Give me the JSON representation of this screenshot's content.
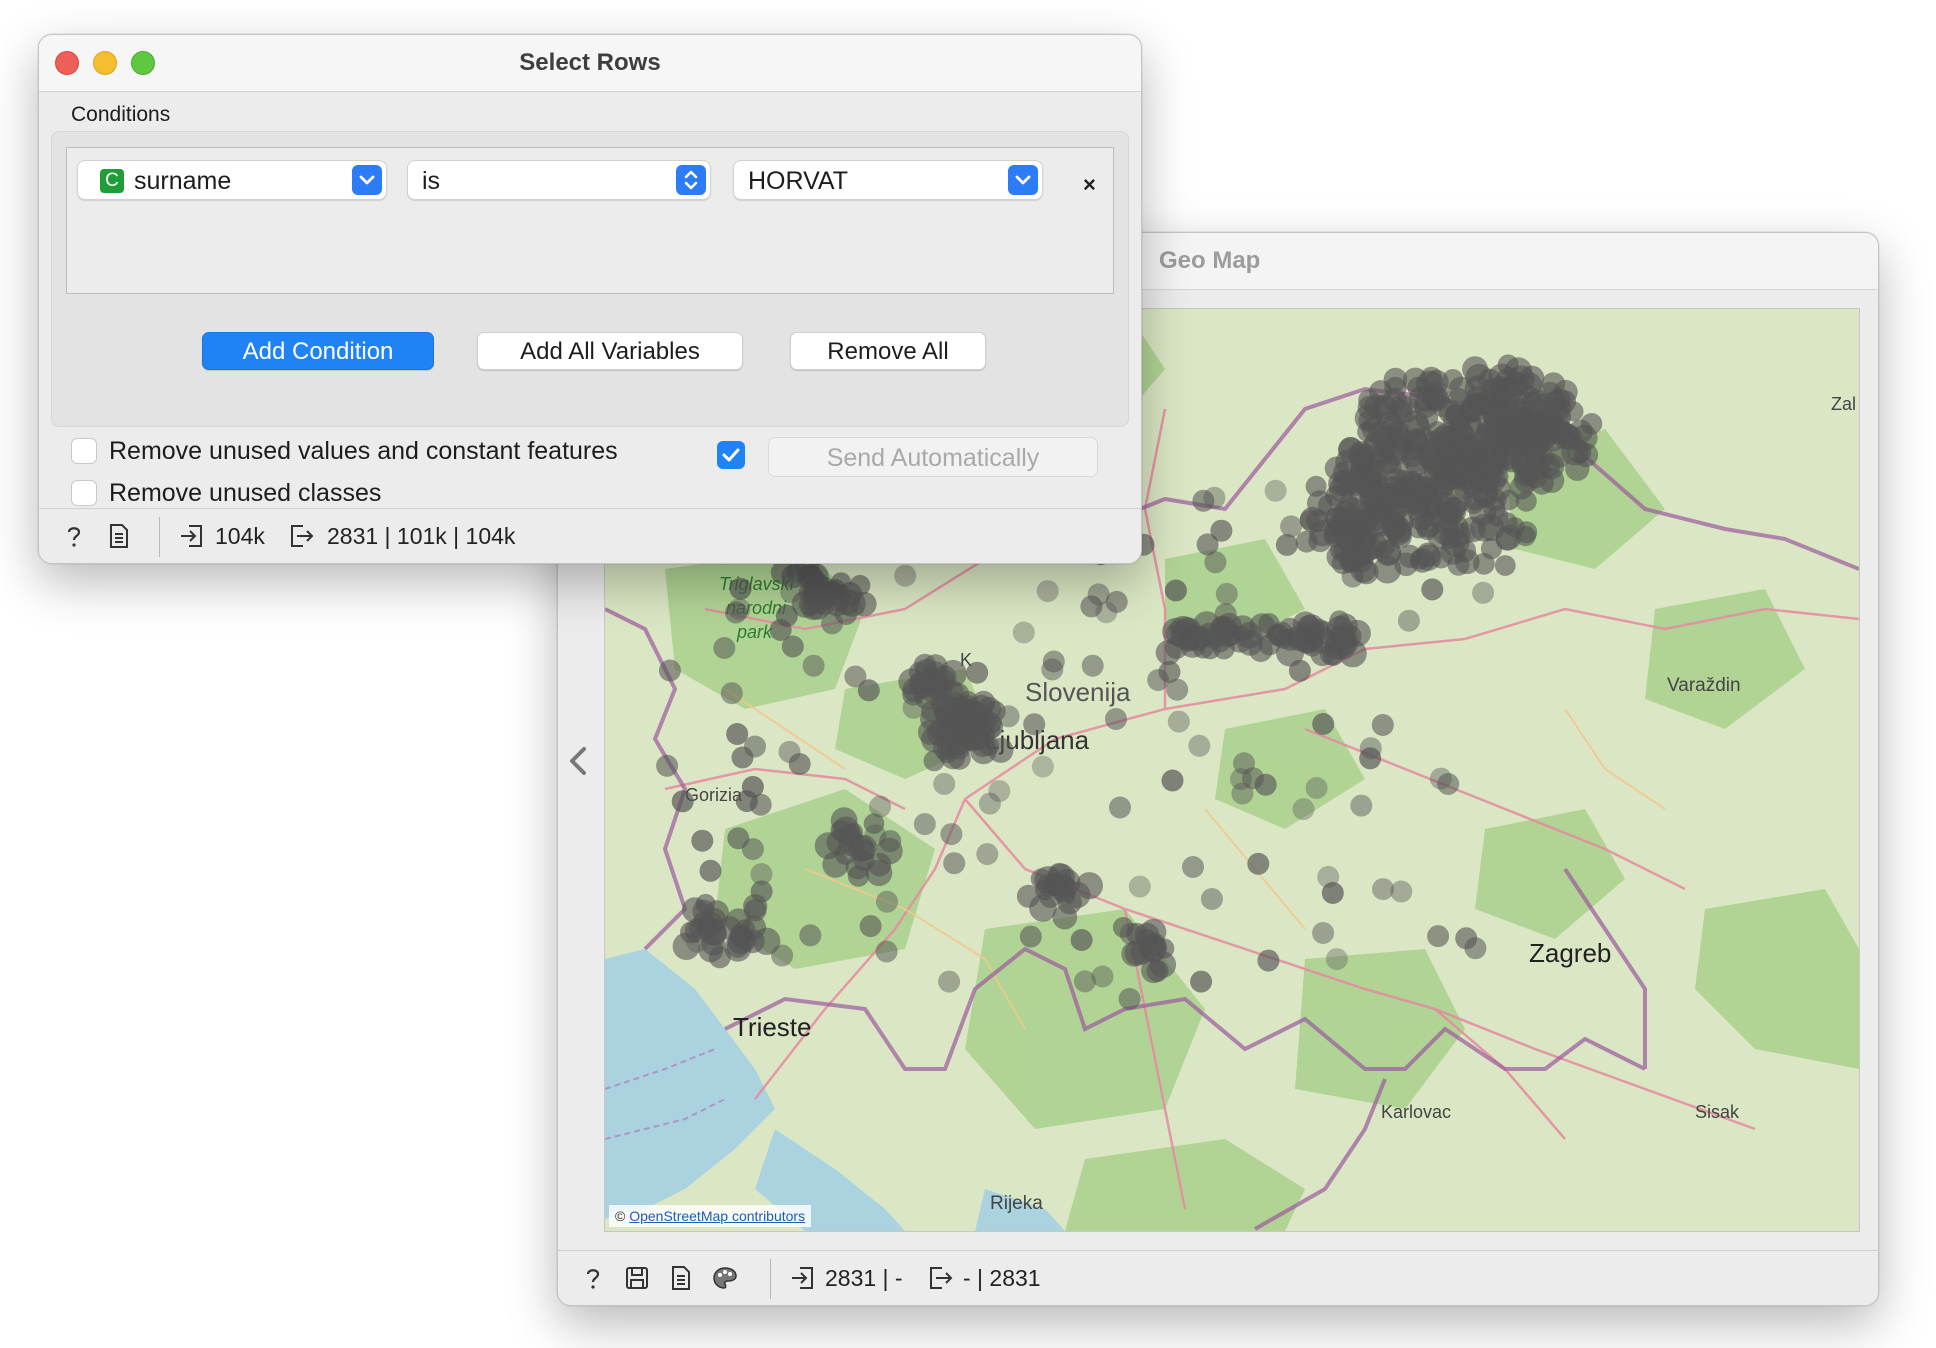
{
  "select_rows": {
    "title": "Select Rows",
    "conditions_label": "Conditions",
    "condition": {
      "variable_type_badge": "C",
      "variable": "surname",
      "operator": "is",
      "value": "HORVAT",
      "remove_symbol": "×"
    },
    "buttons": {
      "add_condition": "Add Condition",
      "add_all_variables": "Add All Variables",
      "remove_all": "Remove All"
    },
    "options": {
      "remove_unused_values": "Remove unused values and constant features",
      "remove_unused_classes": "Remove unused classes",
      "send_automatically": "Send Automatically"
    },
    "status": {
      "input_count": "104k",
      "output_counts": "2831 | 101k | 104k"
    }
  },
  "geo_map": {
    "title": "Geo Map",
    "attribution_prefix": "©",
    "attribution_link": "OpenStreetMap contributors",
    "place_labels": [
      "Triglavski",
      "narodni",
      "park",
      "Slovenija",
      "Ljubljana",
      "Gorizia",
      "Trieste",
      "Zagreb",
      "Varaždin",
      "Karlovac",
      "Sisak",
      "Rijeka",
      "Zal",
      "K"
    ],
    "status": {
      "input_count": "2831 | -",
      "output_count": "- | 2831"
    }
  },
  "colors": {
    "accent": "#1f82f5",
    "map_land": "#d9e8c3",
    "map_forest": "#a9d08e",
    "map_water": "#aad3df",
    "point": "#555555",
    "border": "#9c5a9e"
  }
}
